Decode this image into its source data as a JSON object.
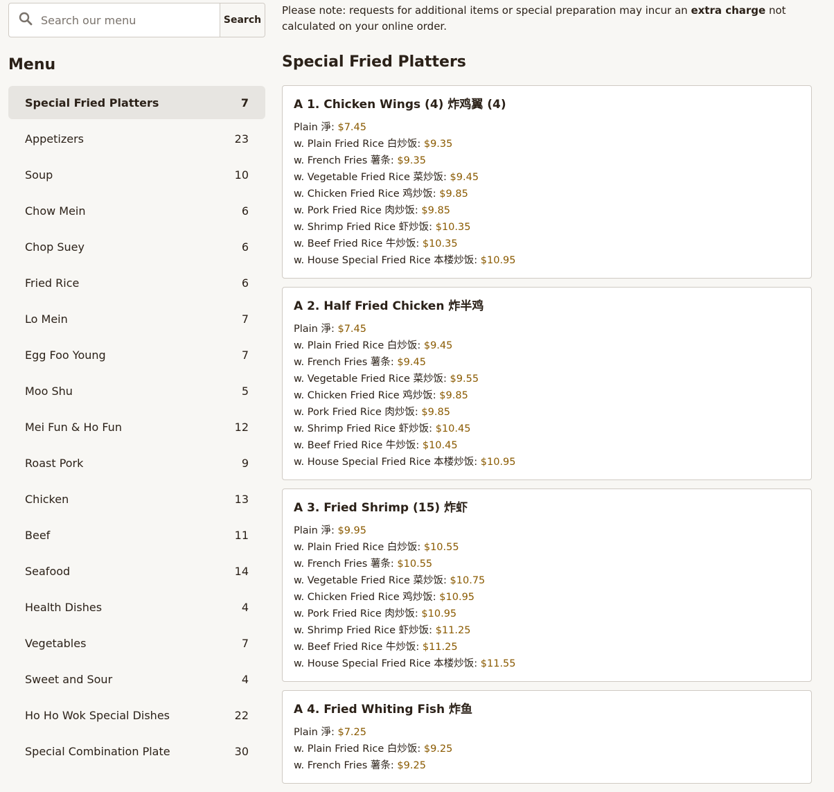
{
  "search": {
    "placeholder": "Search our menu",
    "button_label": "Search",
    "icon": "search-icon"
  },
  "menu_heading": "Menu",
  "categories": [
    {
      "label": "Special Fried Platters",
      "count": "7",
      "active": true
    },
    {
      "label": "Appetizers",
      "count": "23"
    },
    {
      "label": "Soup",
      "count": "10"
    },
    {
      "label": "Chow Mein",
      "count": "6"
    },
    {
      "label": "Chop Suey",
      "count": "6"
    },
    {
      "label": "Fried Rice",
      "count": "6"
    },
    {
      "label": "Lo Mein",
      "count": "7"
    },
    {
      "label": "Egg Foo Young",
      "count": "7"
    },
    {
      "label": "Moo Shu",
      "count": "5"
    },
    {
      "label": "Mei Fun & Ho Fun",
      "count": "12"
    },
    {
      "label": "Roast Pork",
      "count": "9"
    },
    {
      "label": "Chicken",
      "count": "13"
    },
    {
      "label": "Beef",
      "count": "11"
    },
    {
      "label": "Seafood",
      "count": "14"
    },
    {
      "label": "Health Dishes",
      "count": "4"
    },
    {
      "label": "Vegetables",
      "count": "7"
    },
    {
      "label": "Sweet and Sour",
      "count": "4"
    },
    {
      "label": "Ho Ho Wok Special Dishes",
      "count": "22"
    },
    {
      "label": "Special Combination Plate",
      "count": "30"
    }
  ],
  "notice": {
    "before": "Please note: requests for additional items or special preparation may incur an ",
    "bold": "extra charge",
    "after": " not calculated on your online order."
  },
  "section_title": "Special Fried Platters",
  "items": [
    {
      "name": "A 1. Chicken Wings (4) 炸鸡翼 (4)",
      "options": [
        {
          "label": "Plain 淨: ",
          "price": "$7.45"
        },
        {
          "label": "w. Plain Fried Rice 白炒饭: ",
          "price": "$9.35"
        },
        {
          "label": "w. French Fries 薯条: ",
          "price": "$9.35"
        },
        {
          "label": "w. Vegetable Fried Rice 菜炒饭: ",
          "price": "$9.45"
        },
        {
          "label": "w. Chicken Fried Rice 鸡炒饭: ",
          "price": "$9.85"
        },
        {
          "label": "w. Pork Fried Rice 肉炒饭: ",
          "price": "$9.85"
        },
        {
          "label": "w. Shrimp Fried Rice 虾炒饭: ",
          "price": "$10.35"
        },
        {
          "label": "w. Beef Fried Rice 牛炒饭: ",
          "price": "$10.35"
        },
        {
          "label": "w. House Special Fried Rice 本楼炒饭: ",
          "price": "$10.95"
        }
      ]
    },
    {
      "name": "A 2. Half Fried Chicken 炸半鸡",
      "options": [
        {
          "label": "Plain 淨: ",
          "price": "$7.45"
        },
        {
          "label": "w. Plain Fried Rice 白炒饭: ",
          "price": "$9.45"
        },
        {
          "label": "w. French Fries 薯条: ",
          "price": "$9.45"
        },
        {
          "label": "w. Vegetable Fried Rice 菜炒饭: ",
          "price": "$9.55"
        },
        {
          "label": "w. Chicken Fried Rice 鸡炒饭: ",
          "price": "$9.85"
        },
        {
          "label": "w. Pork Fried Rice 肉炒饭: ",
          "price": "$9.85"
        },
        {
          "label": "w. Shrimp Fried Rice 虾炒饭: ",
          "price": "$10.45"
        },
        {
          "label": "w. Beef Fried Rice 牛炒饭: ",
          "price": "$10.45"
        },
        {
          "label": "w. House Special Fried Rice 本楼炒饭: ",
          "price": "$10.95"
        }
      ]
    },
    {
      "name": "A 3. Fried Shrimp (15) 炸虾",
      "options": [
        {
          "label": "Plain 淨: ",
          "price": "$9.95"
        },
        {
          "label": "w. Plain Fried Rice 白炒饭: ",
          "price": "$10.55"
        },
        {
          "label": "w. French Fries 薯条: ",
          "price": "$10.55"
        },
        {
          "label": "w. Vegetable Fried Rice 菜炒饭: ",
          "price": "$10.75"
        },
        {
          "label": "w. Chicken Fried Rice 鸡炒饭: ",
          "price": "$10.95"
        },
        {
          "label": "w. Pork Fried Rice 肉炒饭: ",
          "price": "$10.95"
        },
        {
          "label": "w. Shrimp Fried Rice 虾炒饭: ",
          "price": "$11.25"
        },
        {
          "label": "w. Beef Fried Rice 牛炒饭: ",
          "price": "$11.25"
        },
        {
          "label": "w. House Special Fried Rice 本楼炒饭: ",
          "price": "$11.55"
        }
      ]
    },
    {
      "name": "A 4. Fried Whiting Fish 炸鱼",
      "options": [
        {
          "label": "Plain 淨: ",
          "price": "$7.25"
        },
        {
          "label": "w. Plain Fried Rice 白炒饭: ",
          "price": "$9.25"
        },
        {
          "label": "w. French Fries 薯条: ",
          "price": "$9.25"
        }
      ]
    }
  ],
  "colors": {
    "price": "#8a5a00",
    "active_category_bg": "#e7e5e1",
    "page_bg": "#f8f7f4"
  }
}
